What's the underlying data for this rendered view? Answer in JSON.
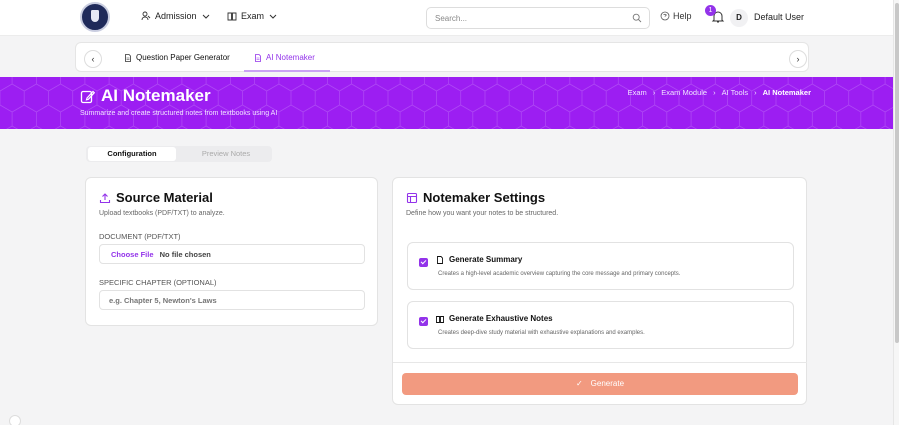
{
  "topnav": {
    "admission_label": "Admission",
    "exam_label": "Exam",
    "search_placeholder": "Search...",
    "help_label": "Help",
    "notification_count": "1",
    "avatar_initial": "D",
    "user_name": "Default User"
  },
  "tabs": [
    {
      "label": "Question Paper Generator",
      "active": false
    },
    {
      "label": "AI Notemaker",
      "active": true
    }
  ],
  "banner": {
    "title": "AI Notemaker",
    "subtitle": "Summarize and create structured notes from textbooks using AI",
    "breadcrumb": [
      "Exam",
      "Exam Module",
      "AI Tools",
      "AI Notemaker"
    ],
    "color": "#9c1ef2"
  },
  "view_tabs": {
    "configuration": "Configuration",
    "preview": "Preview Notes"
  },
  "source": {
    "title": "Source Material",
    "description": "Upload textbooks (PDF/TXT) to analyze.",
    "document_label": "DOCUMENT (PDF/TXT)",
    "choose_file": "Choose File",
    "no_file": "No file chosen",
    "chapter_label": "SPECIFIC CHAPTER (OPTIONAL)",
    "chapter_placeholder": "e.g. Chapter 5, Newton's Laws"
  },
  "settings": {
    "title": "Notemaker Settings",
    "description": "Define how you want your notes to be structured.",
    "options": [
      {
        "title": "Generate Summary",
        "description": "Creates a high-level academic overview capturing the core message and primary concepts.",
        "checked": true
      },
      {
        "title": "Generate Exhaustive Notes",
        "description": "Creates deep-dive study material with exhaustive explanations and examples.",
        "checked": true
      }
    ],
    "generate_label": "Generate"
  },
  "colors": {
    "accent": "#9333ea",
    "generate_button": "#f29a80"
  }
}
